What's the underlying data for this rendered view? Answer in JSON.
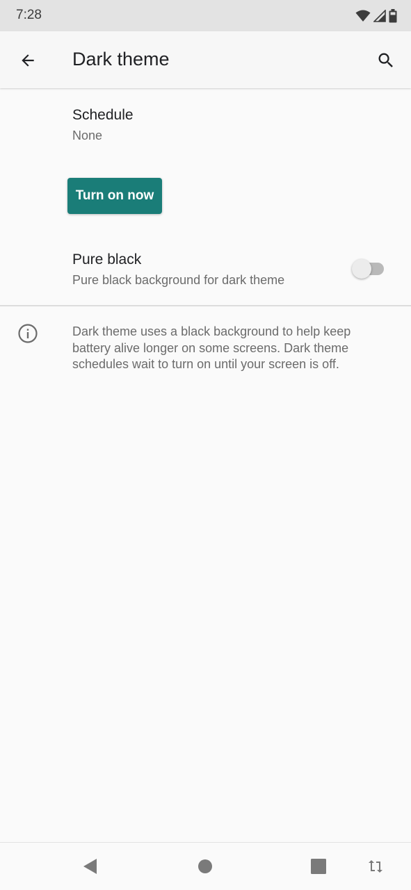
{
  "status_bar": {
    "time": "7:28",
    "icons": [
      "wifi-icon",
      "cellular-signal-icon",
      "battery-icon"
    ]
  },
  "app_bar": {
    "title": "Dark theme",
    "back_icon": "arrow-back-icon",
    "search_icon": "search-icon"
  },
  "schedule": {
    "title": "Schedule",
    "summary": "None"
  },
  "turn_on_button": {
    "label": "Turn on now",
    "color": "#1a7d78"
  },
  "pure_black": {
    "title": "Pure black",
    "summary": "Pure black background for dark theme",
    "enabled": false
  },
  "footer": {
    "icon": "info-icon",
    "text": "Dark theme uses a black background to help keep battery alive longer on some screens. Dark theme schedules wait to turn on until your screen is off."
  },
  "nav_bar": {
    "icons": [
      "back-triangle-icon",
      "home-circle-icon",
      "recents-square-icon",
      "rotate-icon"
    ]
  }
}
